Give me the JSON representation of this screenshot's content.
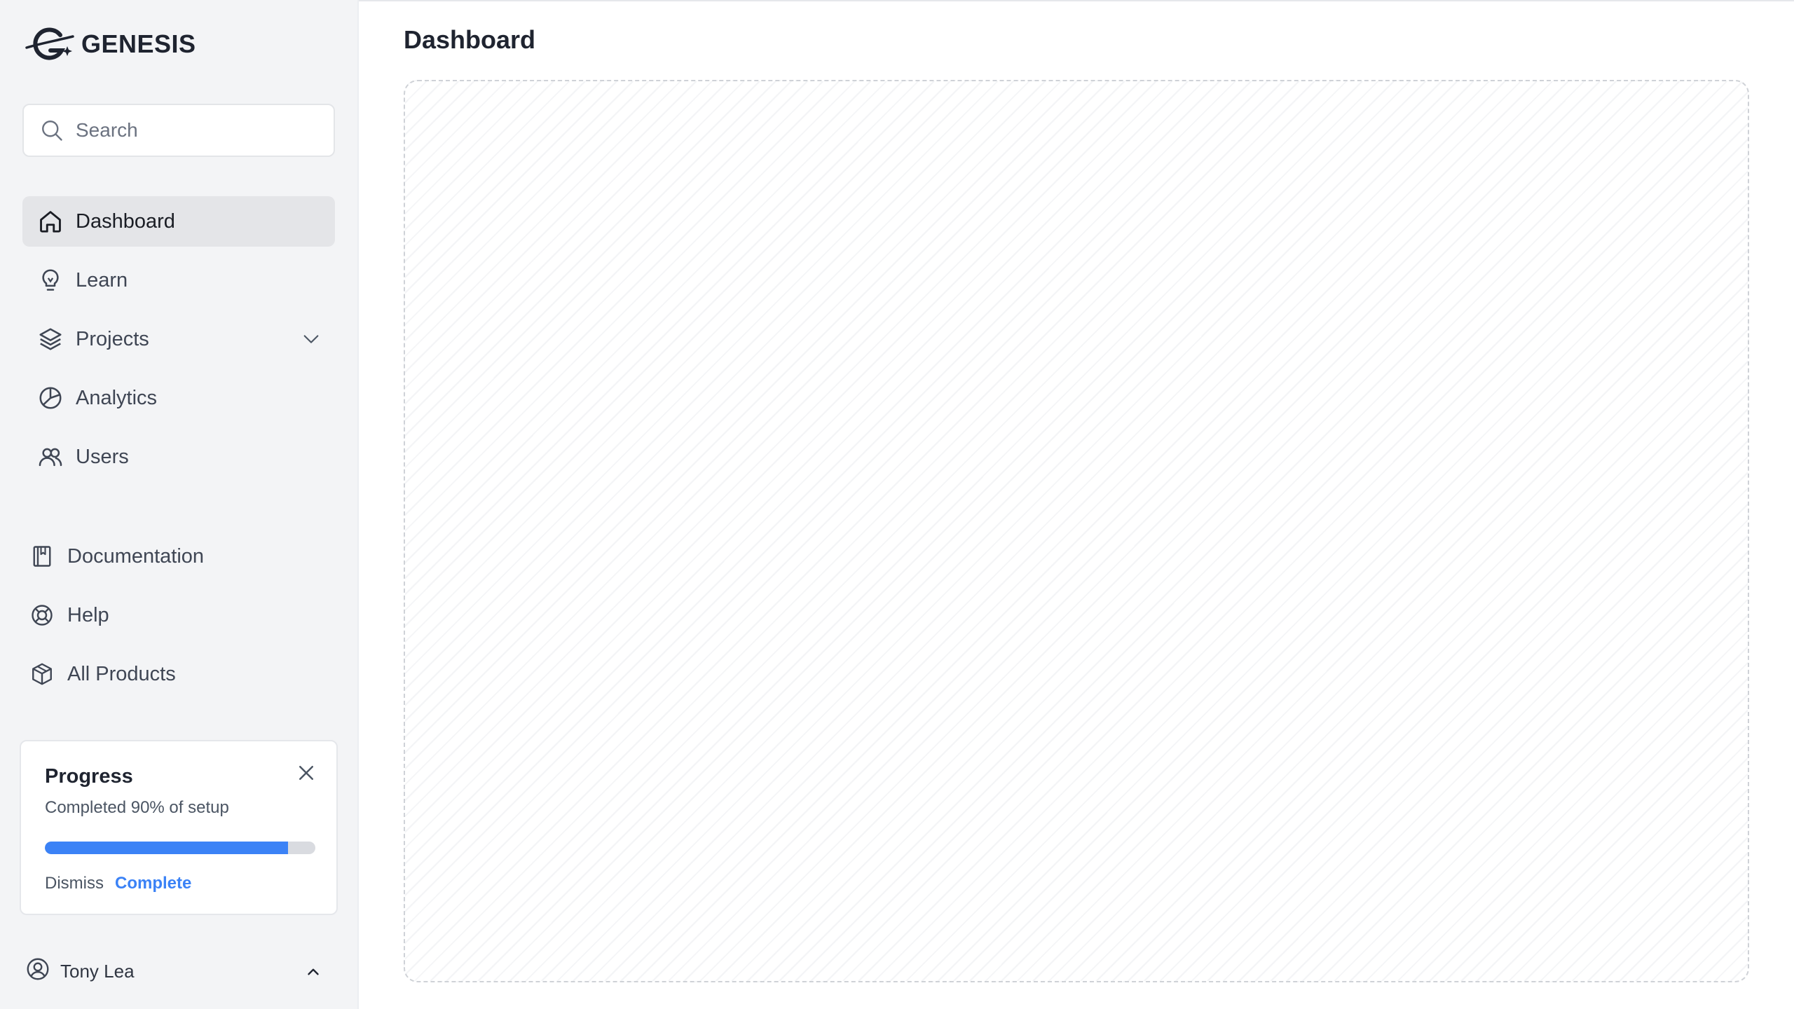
{
  "brand": {
    "name": "GENESIS"
  },
  "search": {
    "placeholder": "Search"
  },
  "nav": {
    "primary": [
      {
        "label": "Dashboard",
        "icon": "home-icon",
        "active": true
      },
      {
        "label": "Learn",
        "icon": "lightbulb-icon"
      },
      {
        "label": "Projects",
        "icon": "layers-icon",
        "has_dropdown": true
      },
      {
        "label": "Analytics",
        "icon": "pie-chart-icon"
      },
      {
        "label": "Users",
        "icon": "users-icon"
      }
    ],
    "secondary": [
      {
        "label": "Documentation",
        "icon": "book-icon"
      },
      {
        "label": "Help",
        "icon": "lifebuoy-icon"
      },
      {
        "label": "All Products",
        "icon": "cube-icon"
      }
    ]
  },
  "progress": {
    "title": "Progress",
    "subtitle": "Completed 90% of setup",
    "percent": 90,
    "dismiss_label": "Dismiss",
    "complete_label": "Complete"
  },
  "user": {
    "name": "Tony Lea"
  },
  "main": {
    "title": "Dashboard"
  },
  "colors": {
    "accent": "#3b82f6",
    "sidebar_bg": "#f3f4f6",
    "active_bg": "#e4e5e8"
  }
}
